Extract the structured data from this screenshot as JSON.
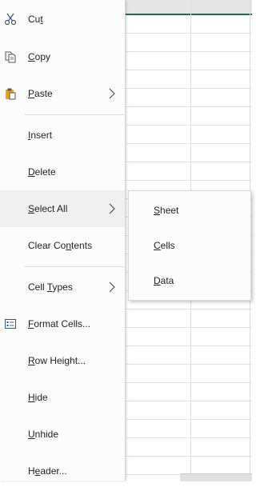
{
  "menu": {
    "items": [
      {
        "id": "cut",
        "pre": "Cu",
        "key": "t",
        "post": "",
        "icon": "scissors-icon"
      },
      {
        "id": "copy",
        "pre": "",
        "key": "C",
        "post": "opy",
        "icon": "copy-icon"
      },
      {
        "id": "paste",
        "pre": "",
        "key": "P",
        "post": "aste",
        "icon": "clipboard-icon",
        "submenu": true
      },
      {
        "id": "insert",
        "pre": "",
        "key": "I",
        "post": "nsert"
      },
      {
        "id": "delete",
        "pre": "",
        "key": "D",
        "post": "elete"
      },
      {
        "id": "select-all",
        "pre": "",
        "key": "S",
        "post": "elect All",
        "submenu": true,
        "highlighted": true
      },
      {
        "id": "clear-contents",
        "pre": "Clear Co",
        "key": "n",
        "post": "tents"
      },
      {
        "id": "cell-types",
        "pre": "Cell ",
        "key": "T",
        "post": "ypes",
        "submenu": true
      },
      {
        "id": "format-cells",
        "pre": "",
        "key": "F",
        "post": "ormat Cells...",
        "icon": "format-cells-icon"
      },
      {
        "id": "row-height",
        "pre": "",
        "key": "R",
        "post": "ow Height..."
      },
      {
        "id": "hide",
        "pre": "",
        "key": "H",
        "post": "ide"
      },
      {
        "id": "unhide",
        "pre": "",
        "key": "U",
        "post": "nhide"
      },
      {
        "id": "header",
        "pre": "H",
        "key": "e",
        "post": "ader..."
      }
    ]
  },
  "submenu": {
    "items": [
      {
        "id": "sheet",
        "pre": "",
        "key": "S",
        "post": "heet"
      },
      {
        "id": "cells",
        "pre": "",
        "key": "C",
        "post": "ells"
      },
      {
        "id": "data",
        "pre": "",
        "key": "D",
        "post": "ata"
      }
    ]
  },
  "colors": {
    "accent_green": "#1e7145",
    "menu_bg": "#fcfcfc",
    "highlight_bg": "#f0f0f0",
    "clipboard_orange": "#e8a317",
    "icon_blue": "#2b579a"
  }
}
